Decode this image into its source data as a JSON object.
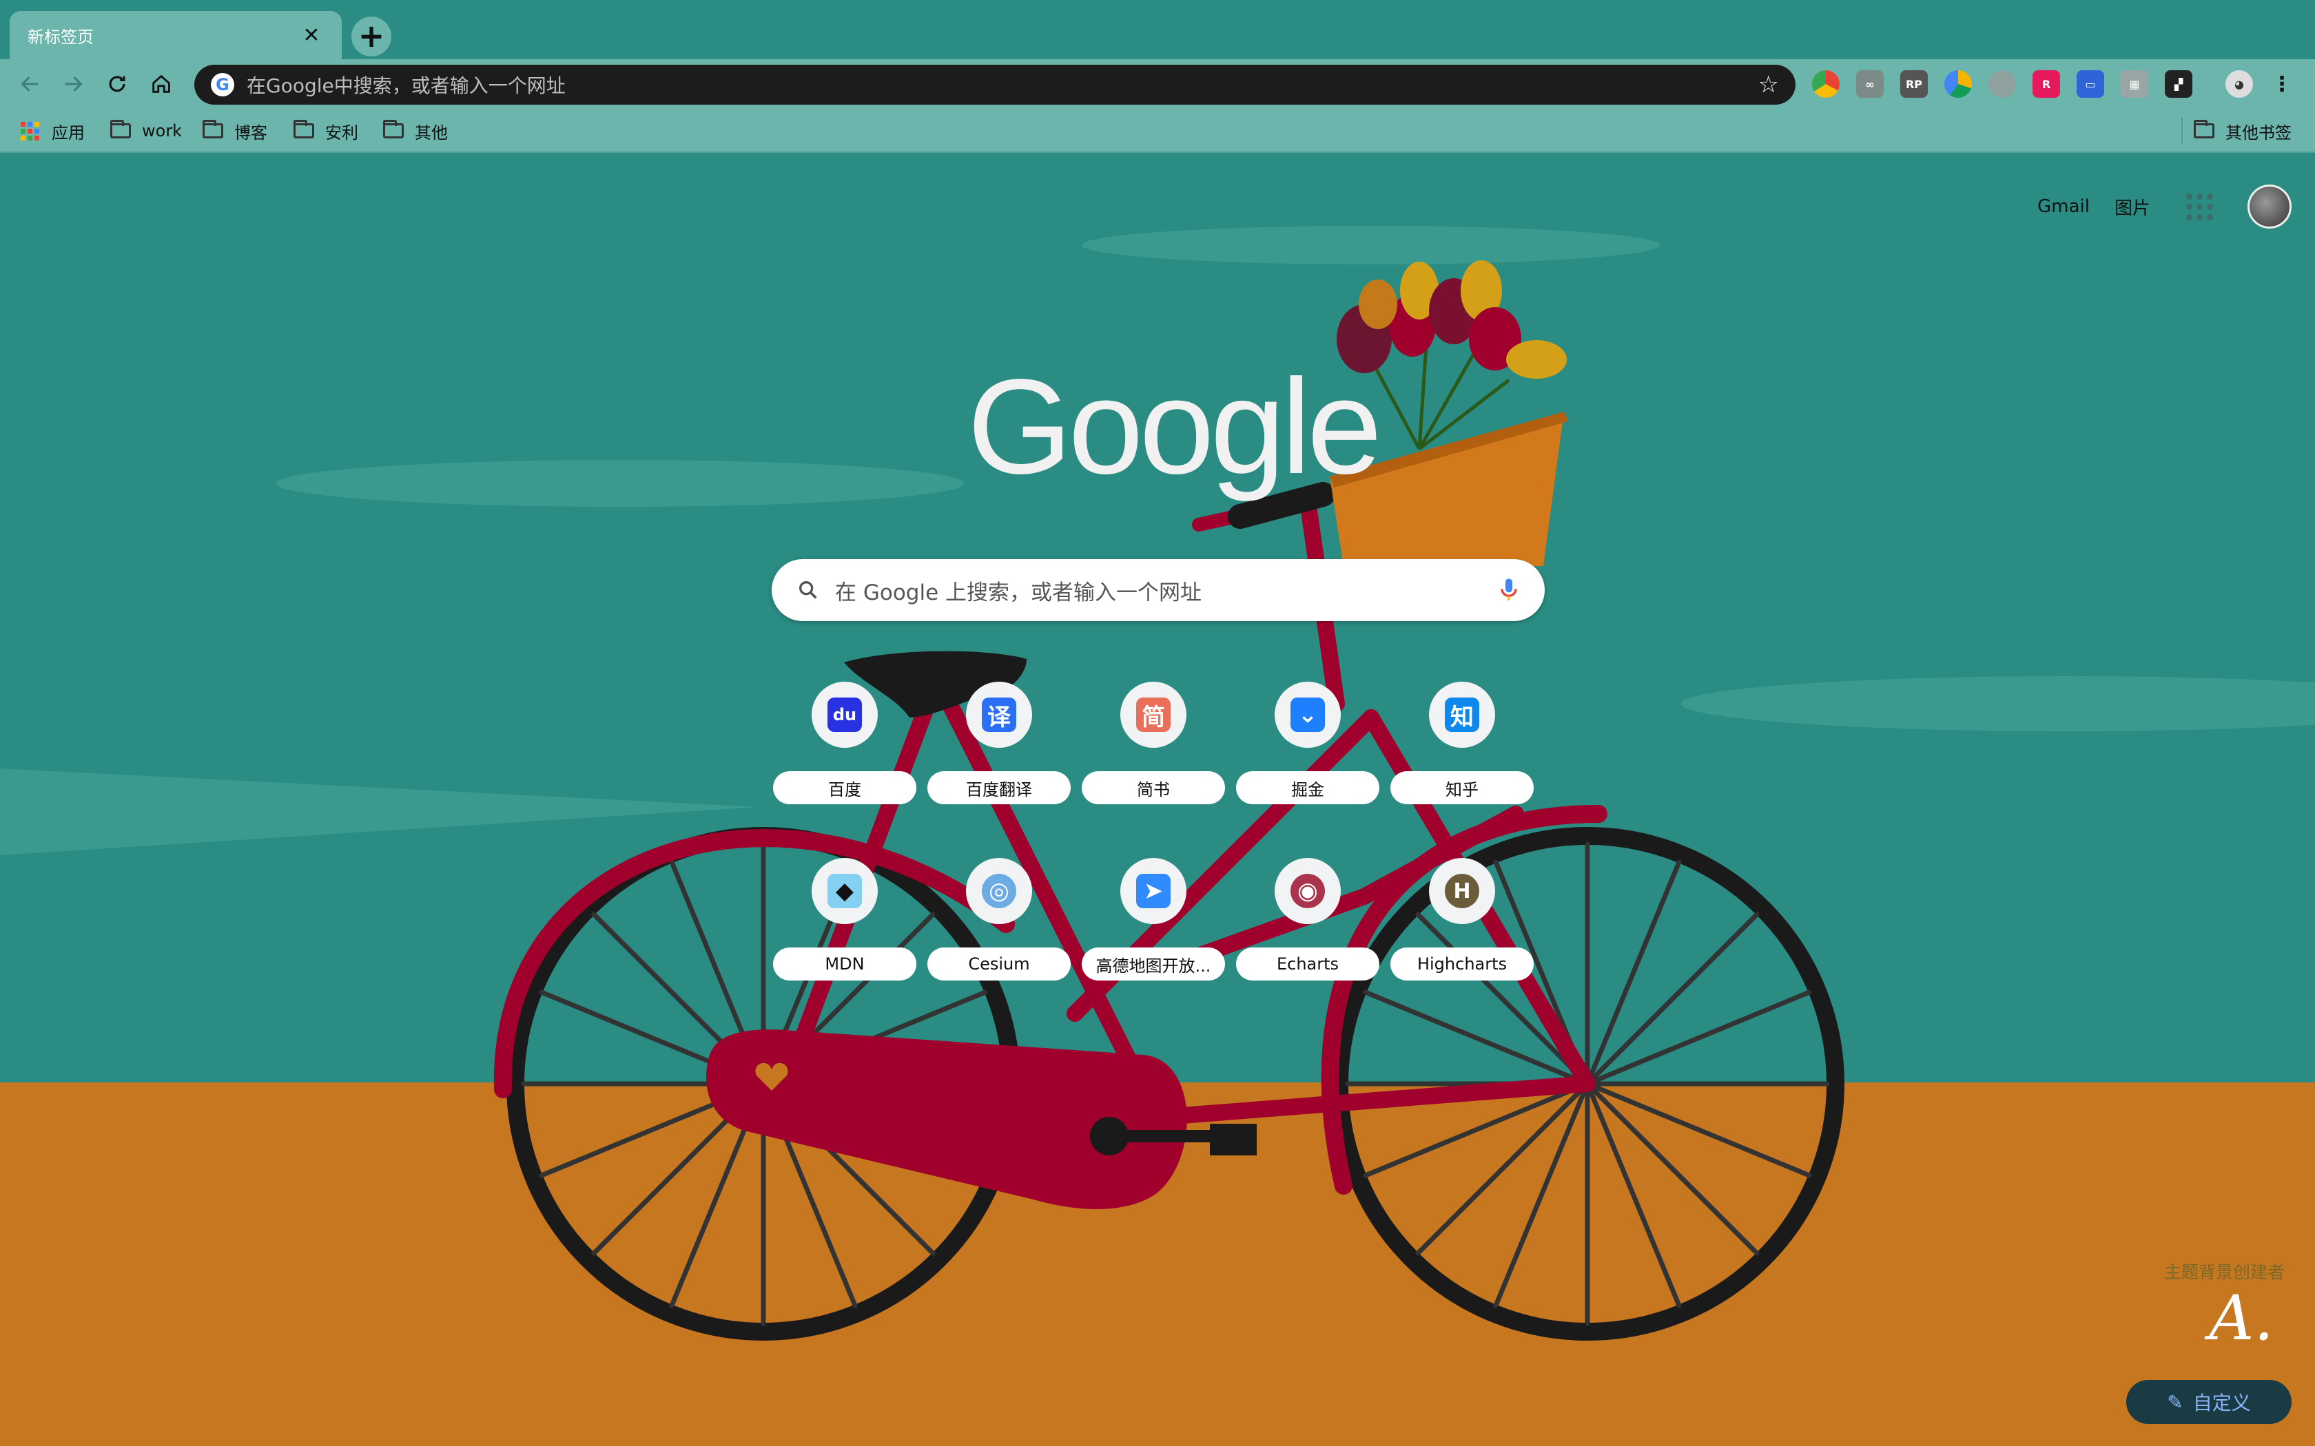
{
  "tab": {
    "title": "新标签页",
    "close": "✕"
  },
  "new_tab": "+",
  "omnibox": {
    "placeholder": "在Google中搜索，或者输入一个网址"
  },
  "bookmarks": {
    "apps": "应用",
    "items": [
      "work",
      "博客",
      "安利",
      "其他"
    ],
    "other": "其他书签"
  },
  "extensions": [
    "chrome-icon",
    "eyes-icon",
    "rp-icon",
    "color-icon",
    "shield-icon",
    "red-icon",
    "blue-icon",
    "gray-icon",
    "dark-icon"
  ],
  "extension_label_rp": "RP",
  "ntp": {
    "gmail": "Gmail",
    "images": "图片",
    "search_placeholder": "在 Google 上搜索，或者输入一个网址",
    "shortcuts": [
      {
        "label": "百度",
        "icon": "baidu-icon",
        "color": "#2932e1",
        "glyph": "du"
      },
      {
        "label": "百度翻译",
        "icon": "translate-icon",
        "color": "#2a6ff5",
        "glyph": "译"
      },
      {
        "label": "简书",
        "icon": "jianshu-icon",
        "color": "#ea6f5a",
        "glyph": "简"
      },
      {
        "label": "掘金",
        "icon": "juejin-icon",
        "color": "#1e80ff",
        "glyph": "⌄"
      },
      {
        "label": "知乎",
        "icon": "zhihu-icon",
        "color": "#0f88eb",
        "glyph": "知"
      },
      {
        "label": "MDN",
        "icon": "mdn-icon",
        "color": "#83d0f2",
        "glyph": "◆"
      },
      {
        "label": "Cesium",
        "icon": "cesium-icon",
        "color": "#6dabe4",
        "glyph": "◎"
      },
      {
        "label": "高德地图开放...",
        "icon": "amap-icon",
        "color": "#2f8bff",
        "glyph": "➤"
      },
      {
        "label": "Echarts",
        "icon": "echarts-icon",
        "color": "#aa344d",
        "glyph": "◉"
      },
      {
        "label": "Highcharts",
        "icon": "highcharts-icon",
        "color": "#6b5d3a",
        "glyph": "H"
      }
    ],
    "credit": "主题背景创建者",
    "customize": "自定义"
  },
  "colors": {
    "sky": "#2a8c82",
    "ground": "#c7771f",
    "bike": "#a0002c",
    "toolbar": "#6bb5ad"
  }
}
